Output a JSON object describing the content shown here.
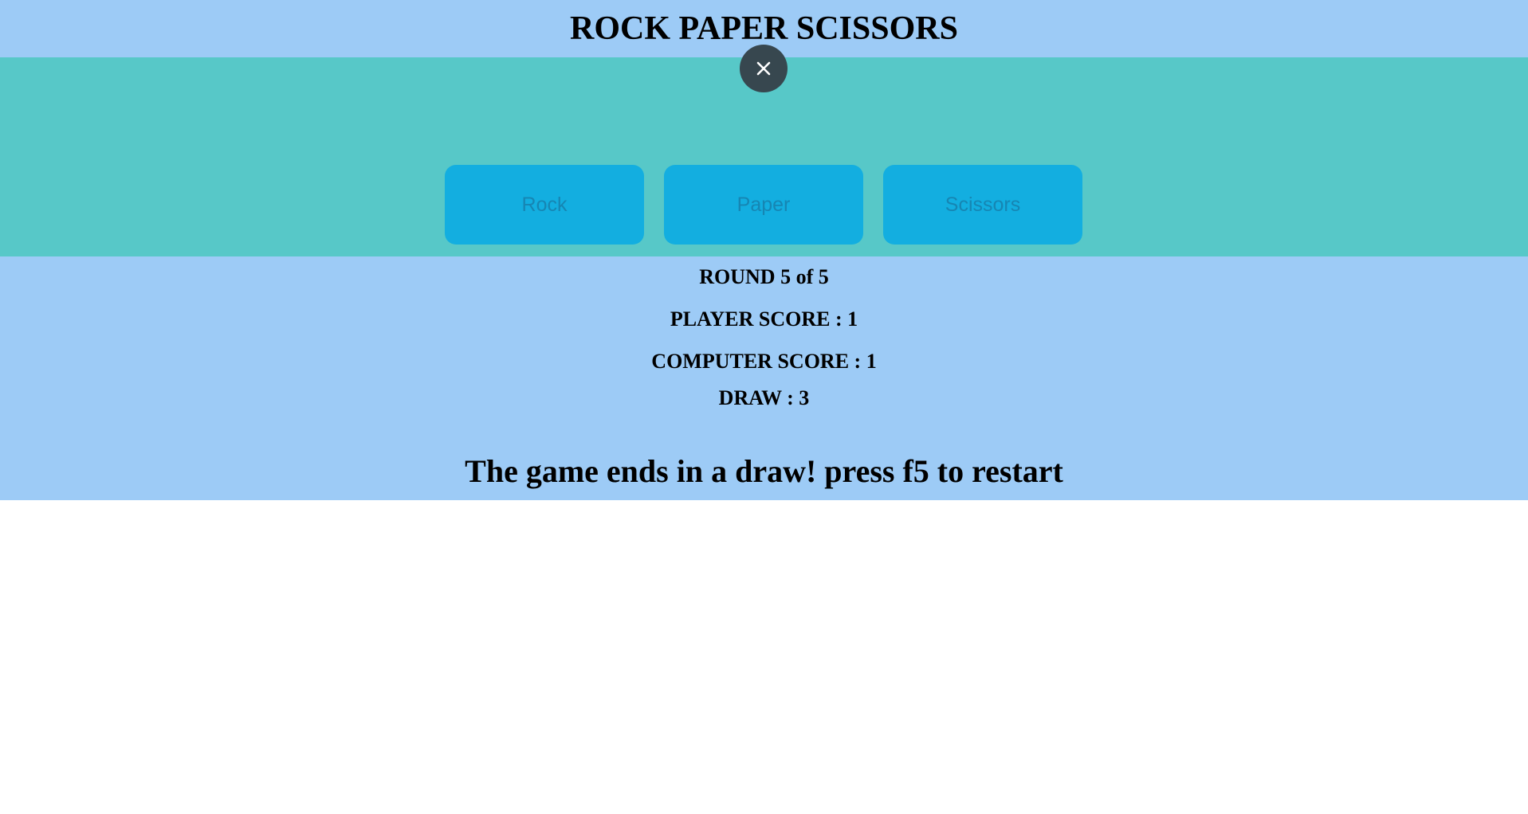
{
  "header": {
    "title": "ROCK PAPER SCISSORS"
  },
  "controls": {
    "close_icon": "close-icon",
    "choices": [
      {
        "label": "Rock"
      },
      {
        "label": "Paper"
      },
      {
        "label": "Scissors"
      }
    ]
  },
  "scoreboard": {
    "round": "ROUND 5 of 5",
    "player_score": "PLAYER SCORE : 1",
    "computer_score": "COMPUTER SCORE : 1",
    "draw": "DRAW : 3",
    "result": "The game ends in a draw! press f5 to restart"
  },
  "colors": {
    "header_bg": "#9dcbf6",
    "arena_bg": "#57c8c8",
    "button_bg": "#13aee0",
    "button_text": "#1686b3",
    "close_bg": "#37474f"
  }
}
